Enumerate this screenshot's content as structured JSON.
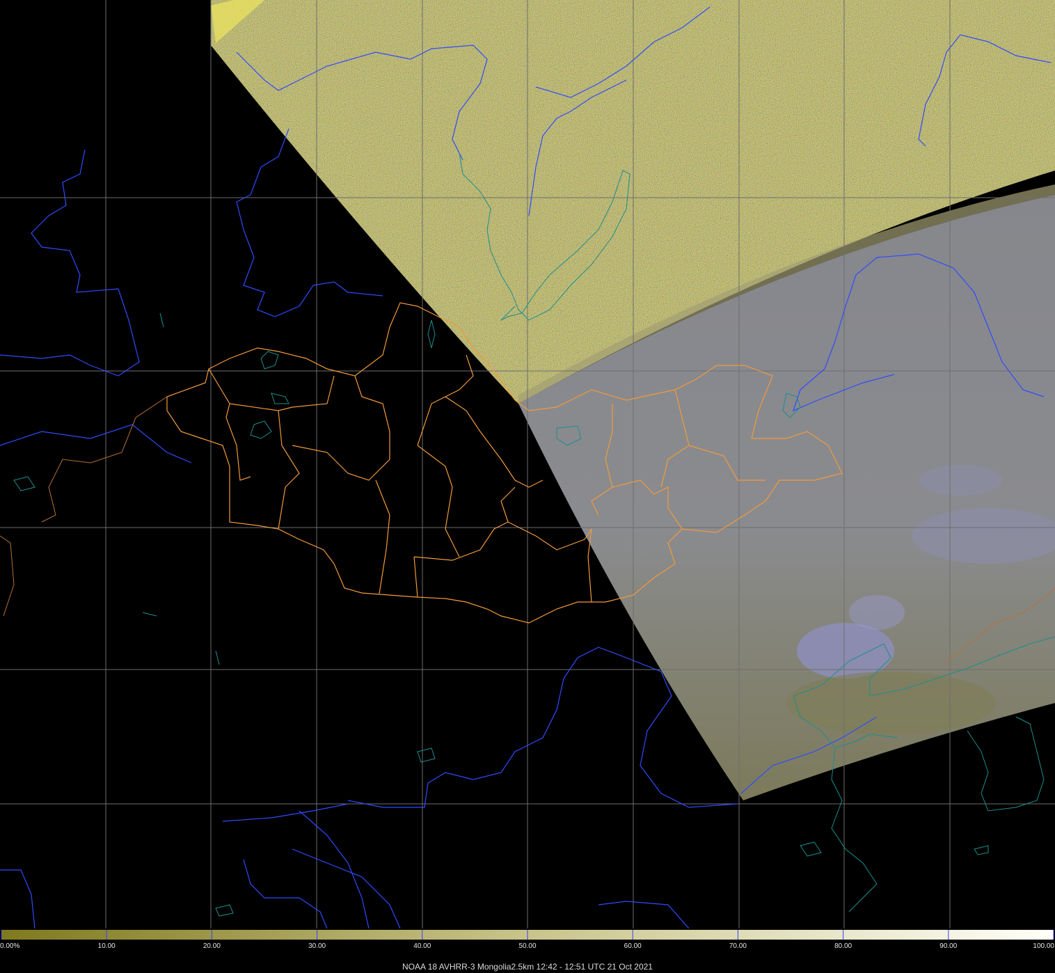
{
  "caption": "NOAA 18 AVHRR-3 Mongolia2.5km 12:42 - 12:51 UTC 21 Oct 2021",
  "colorbar": {
    "tick_labels": [
      "0.00%",
      "10.00",
      "20.00",
      "30.00",
      "40.00",
      "50.00",
      "60.00",
      "70.00",
      "80.00",
      "90.00",
      "100.00"
    ],
    "color_start": "#7f7a1e",
    "color_end": "#fffff8"
  },
  "colors": {
    "background": "#000000",
    "noise_swath": "#bdb55a",
    "clear_swath": "#878a8e",
    "cloud_tint": "#8f90c8",
    "grid": "#6e6e6e",
    "rivers": "#2f4bff",
    "coastlines": "#1a8f8f",
    "provinces": "#f29a3a"
  }
}
